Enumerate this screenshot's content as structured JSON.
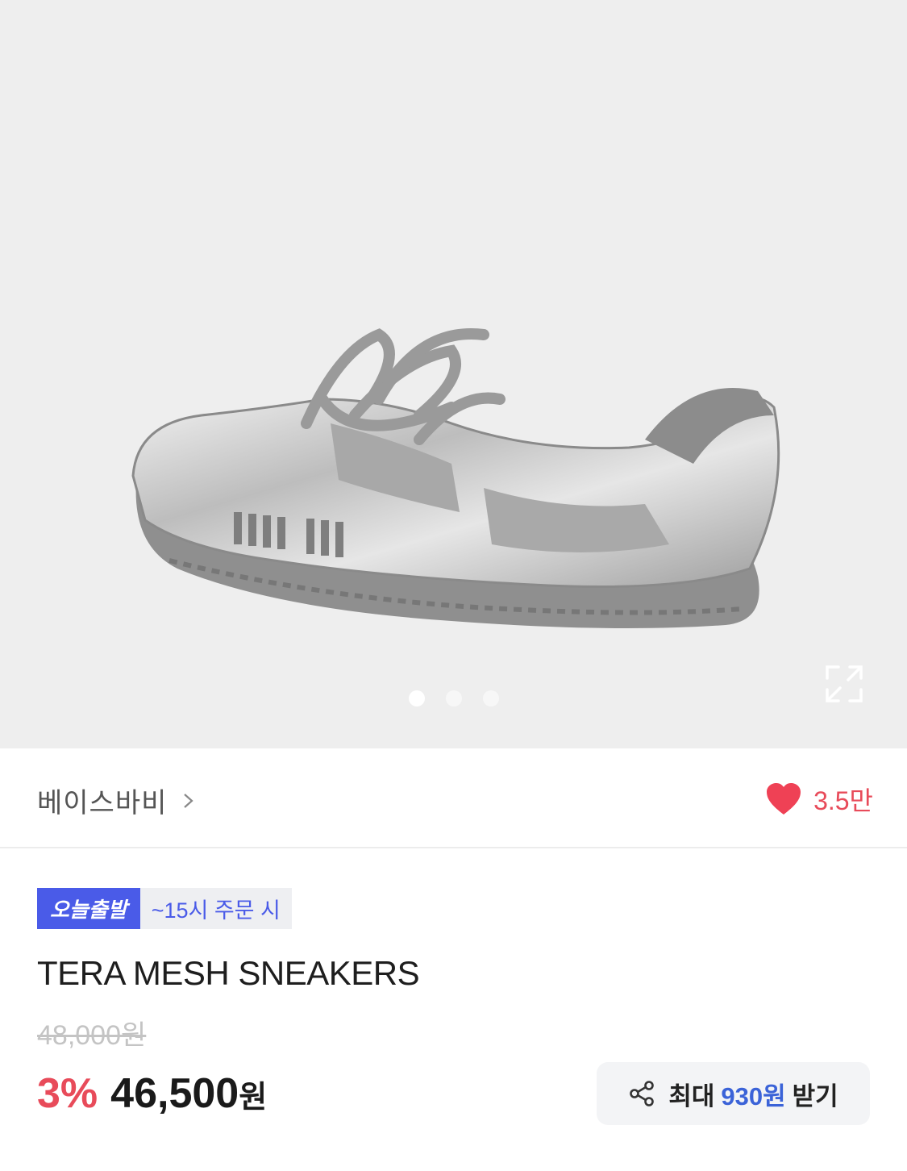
{
  "product_image": {
    "icon": "sneaker-image",
    "pagination": {
      "total": 3,
      "active": 0
    },
    "expand_icon": "expand-icon"
  },
  "brand": {
    "name": "베이스바비",
    "chevron": ">"
  },
  "like": {
    "icon": "heart-icon",
    "count": "3.5만",
    "color": "#e84b5a"
  },
  "delivery": {
    "badge": "오늘출발",
    "note": "~15시 주문 시",
    "badge_color": "#4a5be8"
  },
  "product": {
    "title": "TERA MESH SNEAKERS",
    "original_price": "48,000원",
    "discount": "3%",
    "price": "46,500",
    "currency": "원"
  },
  "reward": {
    "icon": "share-icon",
    "prefix": "최대",
    "amount": "930원",
    "suffix": "받기",
    "amount_color": "#3b63d8"
  }
}
